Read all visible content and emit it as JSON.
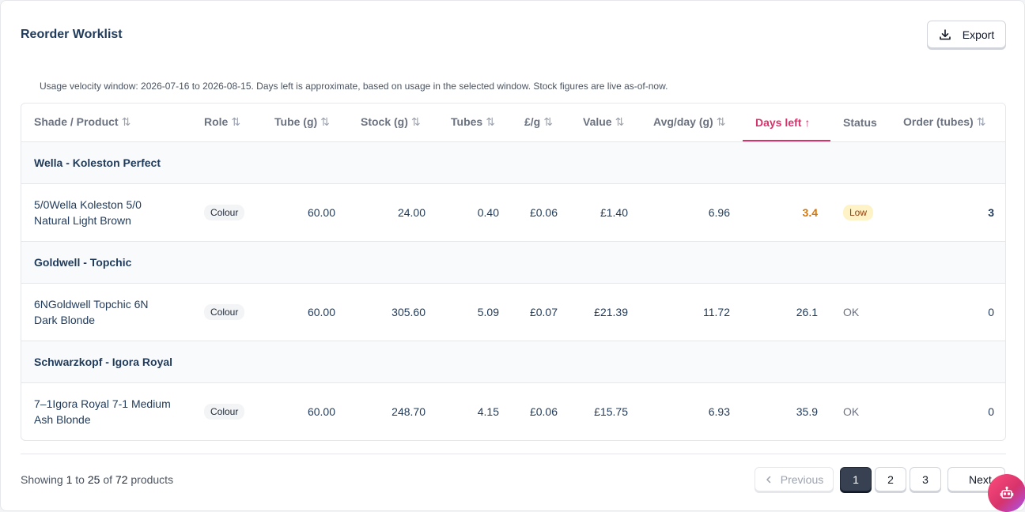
{
  "header": {
    "title": "Reorder Worklist",
    "export_label": "Export"
  },
  "note": "Usage velocity window: 2026-07-16 to 2026-08-15. Days left is approximate, based on usage in the selected window. Stock figures are live as-of-now.",
  "columns": {
    "shade": "Shade / Product",
    "role": "Role",
    "tube": "Tube (g)",
    "stock": "Stock (g)",
    "tubes": "Tubes",
    "ppg": "£/g",
    "value": "Value",
    "avg": "Avg/day (g)",
    "days": "Days left",
    "status": "Status",
    "order": "Order (tubes)"
  },
  "groups": [
    {
      "name": "Wella - Koleston Perfect",
      "item": {
        "name_line1": "5/0Wella Koleston 5/0",
        "name_line2": "Natural Light Brown",
        "role": "Colour",
        "tube": "60.00",
        "stock": "24.00",
        "tubes": "0.40",
        "ppg": "£0.06",
        "value": "£1.40",
        "avg": "6.96",
        "days": "3.4",
        "status": "Low",
        "order": "3"
      }
    },
    {
      "name": "Goldwell - Topchic",
      "item": {
        "name_line1": "6NGoldwell Topchic 6N",
        "name_line2": "Dark Blonde",
        "role": "Colour",
        "tube": "60.00",
        "stock": "305.60",
        "tubes": "5.09",
        "ppg": "£0.07",
        "value": "£21.39",
        "avg": "11.72",
        "days": "26.1",
        "status": "OK",
        "order": "0"
      }
    },
    {
      "name": "Schwarzkopf - Igora Royal",
      "item": {
        "name_line1": "7–1Igora Royal 7-1 Medium",
        "name_line2": "Ash Blonde",
        "role": "Colour",
        "tube": "60.00",
        "stock": "248.70",
        "tubes": "4.15",
        "ppg": "£0.06",
        "value": "£15.75",
        "avg": "6.93",
        "days": "35.9",
        "status": "OK",
        "order": "0"
      }
    }
  ],
  "footer": {
    "showing_prefix": "Showing ",
    "from": "1",
    "to_word": " to ",
    "to": "25",
    "of_word": " of ",
    "total": "72",
    "suffix": " products",
    "prev_label": "Previous",
    "next_label": "Next",
    "pages": [
      "1",
      "2",
      "3"
    ]
  },
  "colors": {
    "accent": "#d6336c",
    "low_text": "#d97706",
    "low_badge": "#fef3c7"
  },
  "icons": {
    "export": "download-icon",
    "sort": "sort-icon",
    "sort_active": "arrow-up-icon",
    "prev": "chevron-left-icon",
    "next": "chevron-right-icon",
    "assistant": "robot-icon"
  }
}
